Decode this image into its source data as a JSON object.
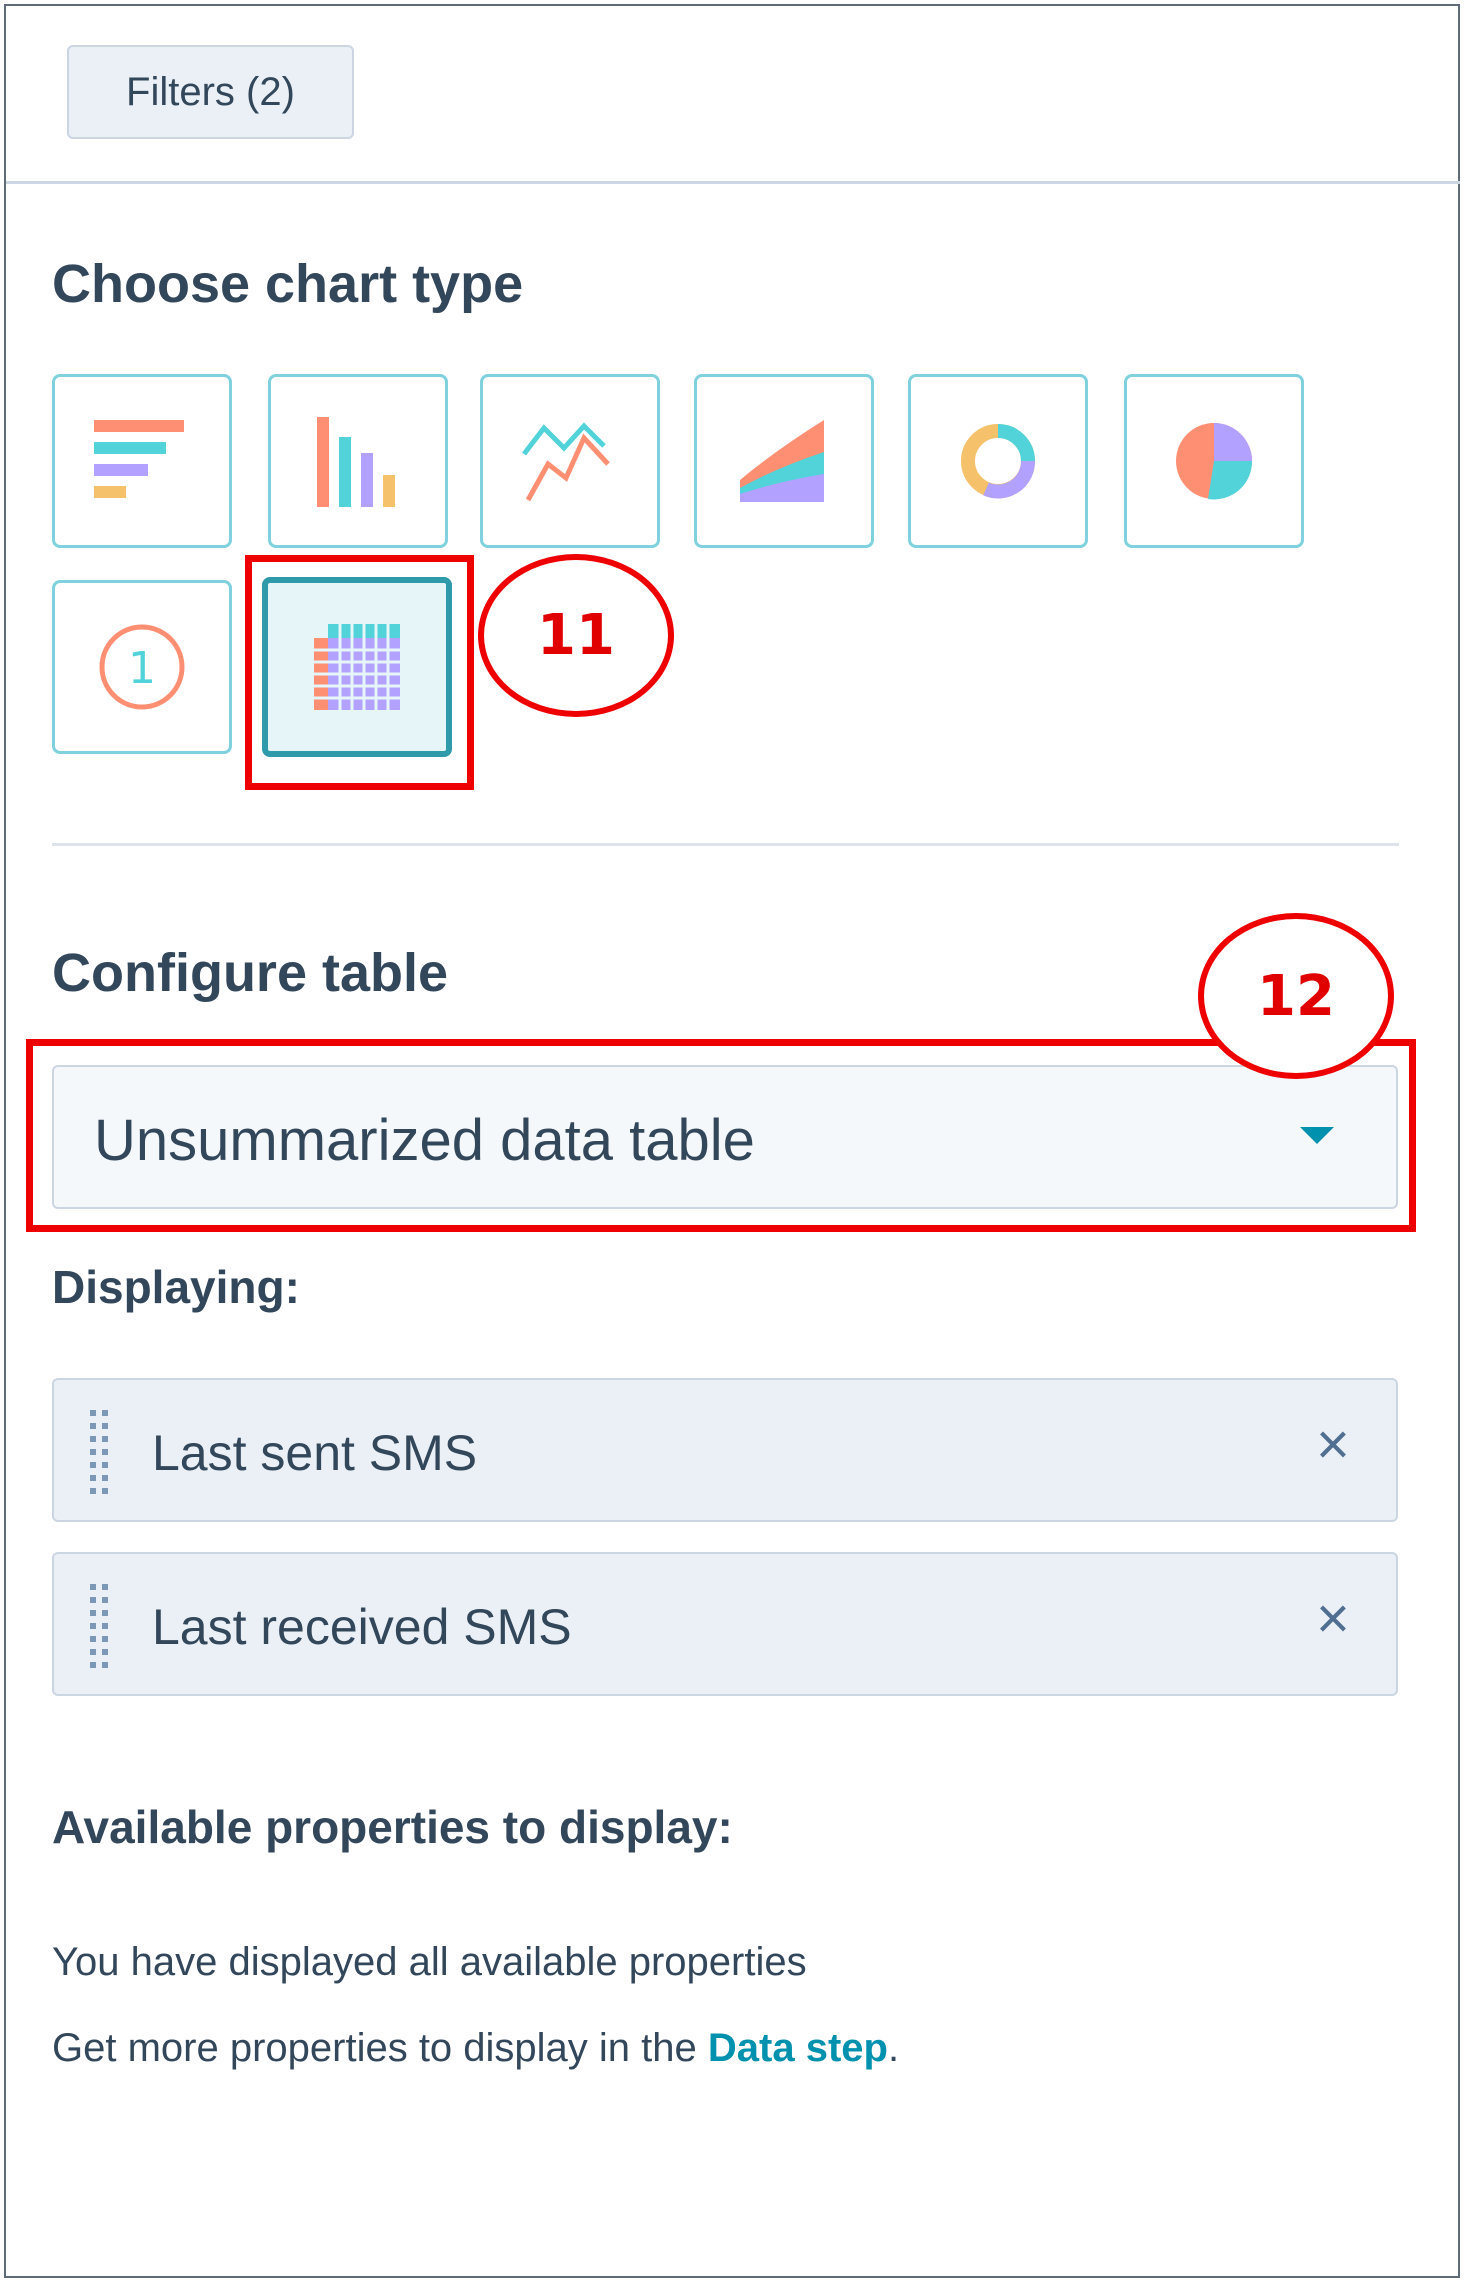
{
  "filters": {
    "label": "Filters (2)"
  },
  "choose_chart": {
    "title": "Choose chart type",
    "types": [
      {
        "icon": "horizontal-bar-chart-icon"
      },
      {
        "icon": "vertical-bar-chart-icon"
      },
      {
        "icon": "line-chart-icon"
      },
      {
        "icon": "area-chart-icon"
      },
      {
        "icon": "donut-chart-icon"
      },
      {
        "icon": "pie-chart-icon"
      },
      {
        "icon": "single-value-icon",
        "glyph": "1"
      },
      {
        "icon": "table-chart-icon",
        "selected": true
      }
    ]
  },
  "annotations": {
    "first": "11",
    "second": "12"
  },
  "configure": {
    "title": "Configure table",
    "dropdown_value": "Unsummarized data table"
  },
  "displaying": {
    "label": "Displaying:",
    "items": [
      {
        "label": "Last sent SMS"
      },
      {
        "label": "Last received SMS"
      }
    ],
    "remove_glyph": "×"
  },
  "available": {
    "title": "Available properties to display:",
    "message": "You have displayed all available properties",
    "hint_prefix": "Get more properties to display in the ",
    "hint_link": "Data step",
    "hint_suffix": "."
  },
  "colors": {
    "teal_border": "#7fd1de",
    "selected_border": "#2f9aa9",
    "annotation_red": "#ee0000",
    "link": "#0091ae"
  }
}
